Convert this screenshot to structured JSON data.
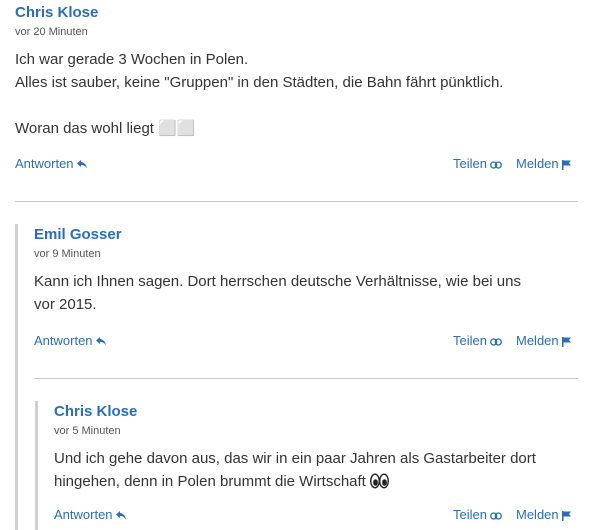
{
  "comments": [
    {
      "author": "Chris Klose",
      "time": "vor 20 Minuten",
      "lines": [
        "Ich war gerade 3 Wochen in Polen.",
        "Alles ist sauber, keine \"Gruppen\" in den Städten, die Bahn fährt pünktlich.",
        "",
        "Woran das wohl liegt ⬜⬜"
      ]
    },
    {
      "author": "Emil Gosser",
      "time": "vor 9 Minuten",
      "lines": [
        "Kann ich Ihnen sagen. Dort herrschen deutsche Verhältnisse, wie bei uns",
        "vor 2015."
      ]
    },
    {
      "author": "Chris Klose",
      "time": "vor 5 Minuten",
      "lines": [
        "Und ich gehe davon aus, das wir in ein paar Jahren als Gastarbeiter dort",
        "hingehen, denn in Polen brummt die Wirtschaft"
      ],
      "trailing_icon": "eyes-emoji"
    }
  ],
  "actions": {
    "reply": "Antworten",
    "share": "Teilen",
    "report": "Melden"
  },
  "colors": {
    "link": "#2a6ebb",
    "text": "#333333",
    "muted": "#555555",
    "divider": "#c8c8c8",
    "thread_line": "#d0d0d0"
  }
}
